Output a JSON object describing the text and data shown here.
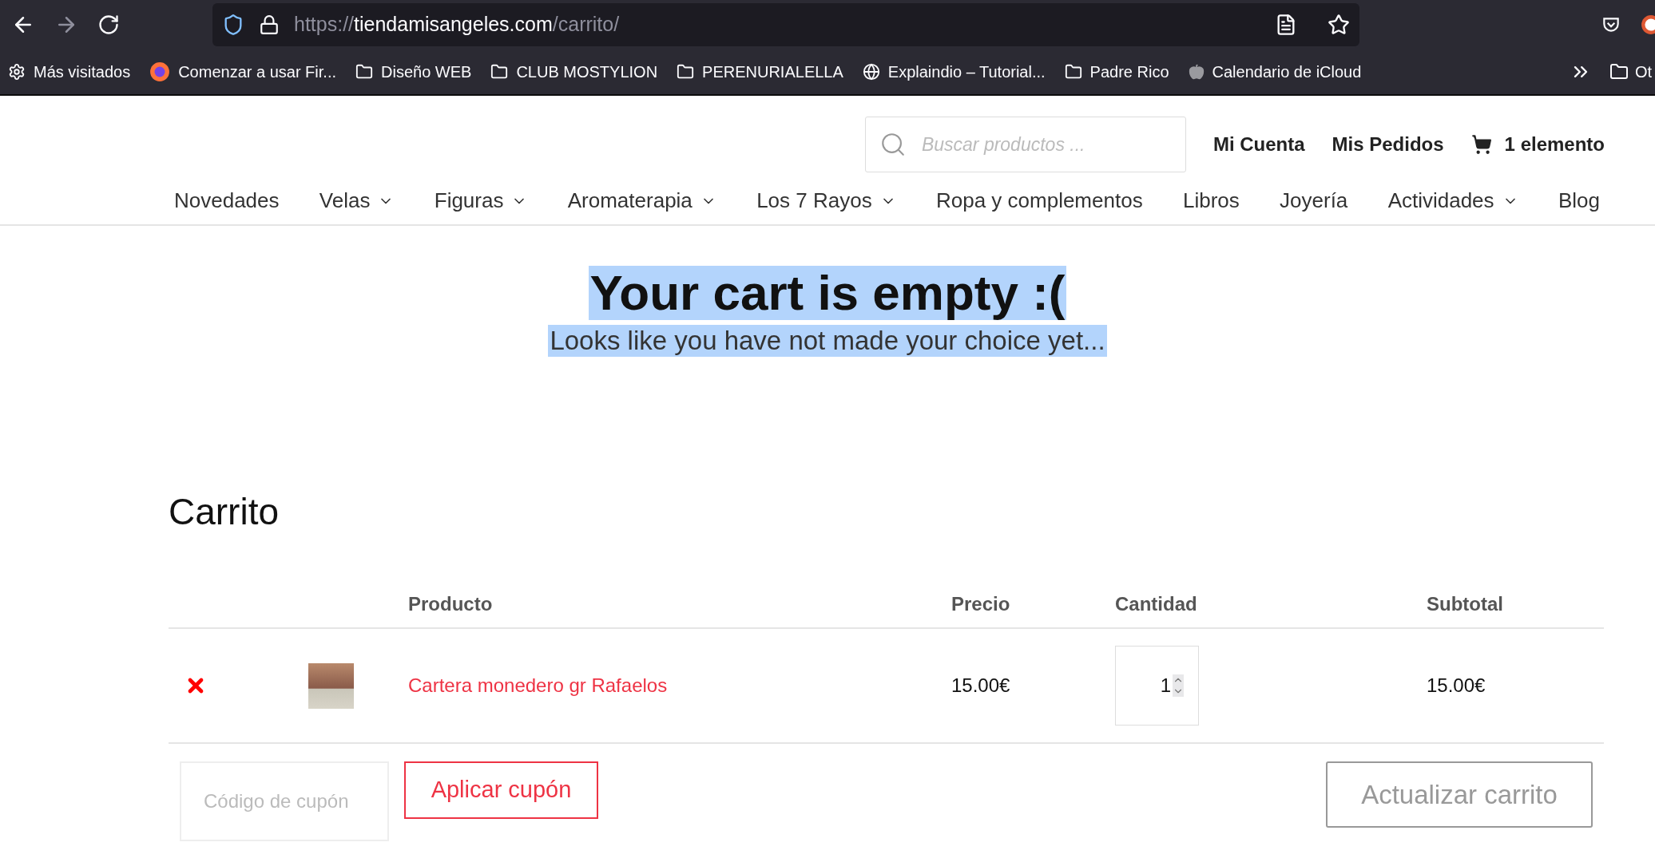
{
  "browser": {
    "url_scheme": "https://",
    "url_host": "tiendamisangeles.com",
    "url_path": "/carrito/",
    "bookmarks": [
      {
        "kind": "gear",
        "label": "Más visitados"
      },
      {
        "kind": "browser",
        "label": "Comenzar a usar Fir..."
      },
      {
        "kind": "folder",
        "label": "Diseño WEB"
      },
      {
        "kind": "folder",
        "label": "CLUB MOSTYLION"
      },
      {
        "kind": "folder",
        "label": "PERENURIALELLA"
      },
      {
        "kind": "globe",
        "label": "Explaindio – Tutorial..."
      },
      {
        "kind": "folder",
        "label": "Padre Rico"
      },
      {
        "kind": "apple",
        "label": "Calendario de iCloud"
      }
    ],
    "overflow_bookmark": "Ot"
  },
  "header": {
    "search": {
      "placeholder": "Buscar productos ..."
    },
    "links": [
      "Mi Cuenta",
      "Mis Pedidos"
    ],
    "cart": "1 elemento"
  },
  "nav": [
    {
      "label": "Novedades",
      "has_menu": false
    },
    {
      "label": "Velas",
      "has_menu": true
    },
    {
      "label": "Figuras",
      "has_menu": true
    },
    {
      "label": "Aromaterapia",
      "has_menu": true
    },
    {
      "label": "Los 7 Rayos",
      "has_menu": true
    },
    {
      "label": "Ropa y complementos",
      "has_menu": false
    },
    {
      "label": "Libros",
      "has_menu": false
    },
    {
      "label": "Joyería",
      "has_menu": false
    },
    {
      "label": "Actividades",
      "has_menu": true
    },
    {
      "label": "Blog",
      "has_menu": false
    }
  ],
  "empty_notice": {
    "title": "Your cart is empty :(",
    "subtitle": "Looks like you have not made your choice yet...",
    "highlighted": true
  },
  "cart": {
    "title": "Carrito",
    "columns": [
      "Producto",
      "Precio",
      "Cantidad",
      "Subtotal"
    ],
    "rows": [
      {
        "product": "Cartera monedero gr Rafaelos",
        "price": "15.00€",
        "quantity": "1",
        "subtotal": "15.00€"
      }
    ],
    "coupon": {
      "placeholder": "Código de cupón"
    },
    "apply_button": "Aplicar cupón",
    "update_button": "Actualizar carrito"
  }
}
